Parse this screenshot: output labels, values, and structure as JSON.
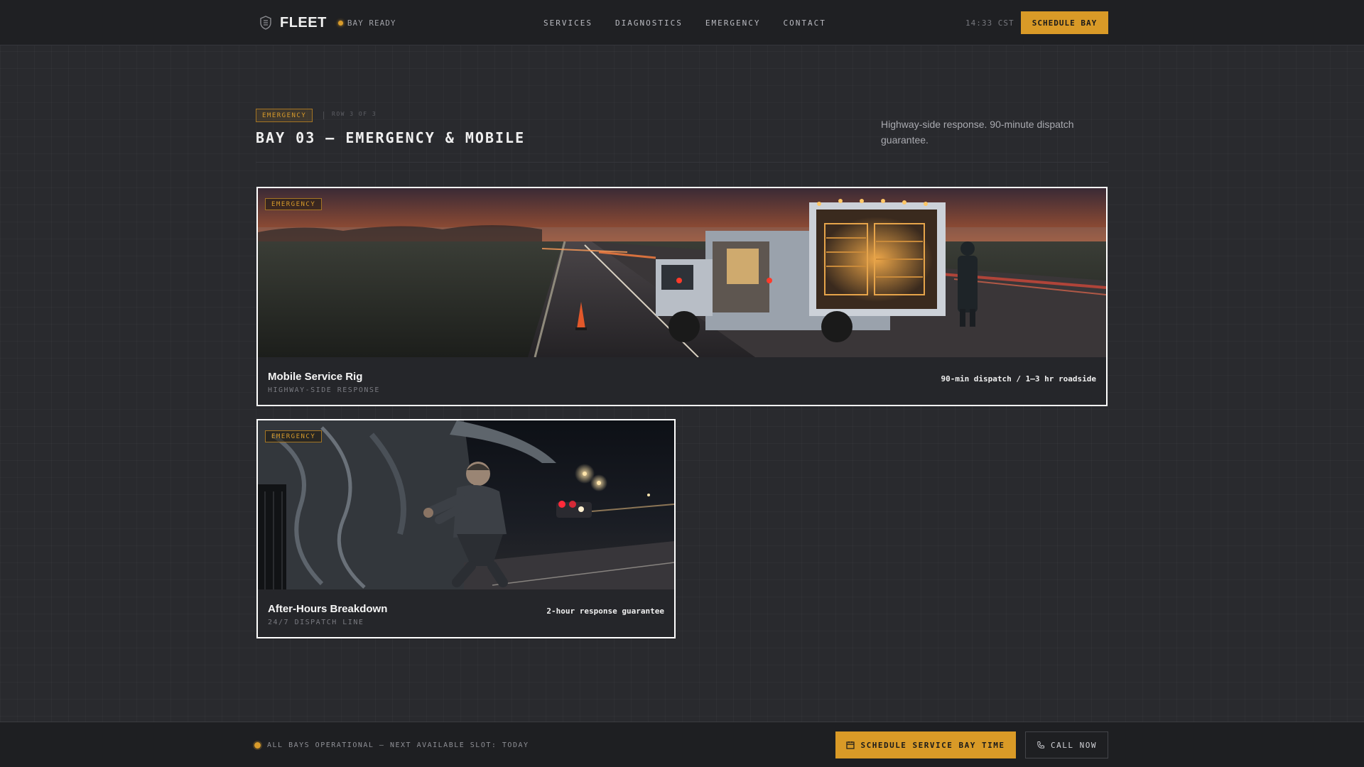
{
  "header": {
    "brand": "FLEET",
    "status": "BAY READY",
    "nav": [
      "SERVICES",
      "DIAGNOSTICS",
      "EMERGENCY",
      "CONTACT"
    ],
    "clock": "14:33 CST",
    "cta": "SCHEDULE BAY"
  },
  "section": {
    "tag": "EMERGENCY",
    "row_label": "ROW 3 OF 3",
    "title": "BAY 03 — EMERGENCY & MOBILE",
    "description": "Highway-side response. 90-minute dispatch guarantee."
  },
  "cards": [
    {
      "tag": "EMERGENCY",
      "title": "Mobile Service Rig",
      "subtitle": "HIGHWAY-SIDE RESPONSE",
      "meta": "90-min dispatch / 1–3 hr roadside"
    },
    {
      "tag": "EMERGENCY",
      "title": "After-Hours Breakdown",
      "subtitle": "24/7 DISPATCH LINE",
      "meta": "2-hour response guarantee"
    }
  ],
  "footer": {
    "status": "ALL BAYS OPERATIONAL — NEXT AVAILABLE SLOT: TODAY",
    "schedule": "SCHEDULE SERVICE BAY TIME",
    "call": "CALL NOW"
  },
  "colors": {
    "accent": "#d99a27",
    "background": "#292a2e",
    "topbar": "#1f2023"
  },
  "icons": {
    "brand": "shield-icon",
    "status": "status-dot-icon",
    "schedule": "calendar-icon",
    "call": "phone-icon"
  }
}
